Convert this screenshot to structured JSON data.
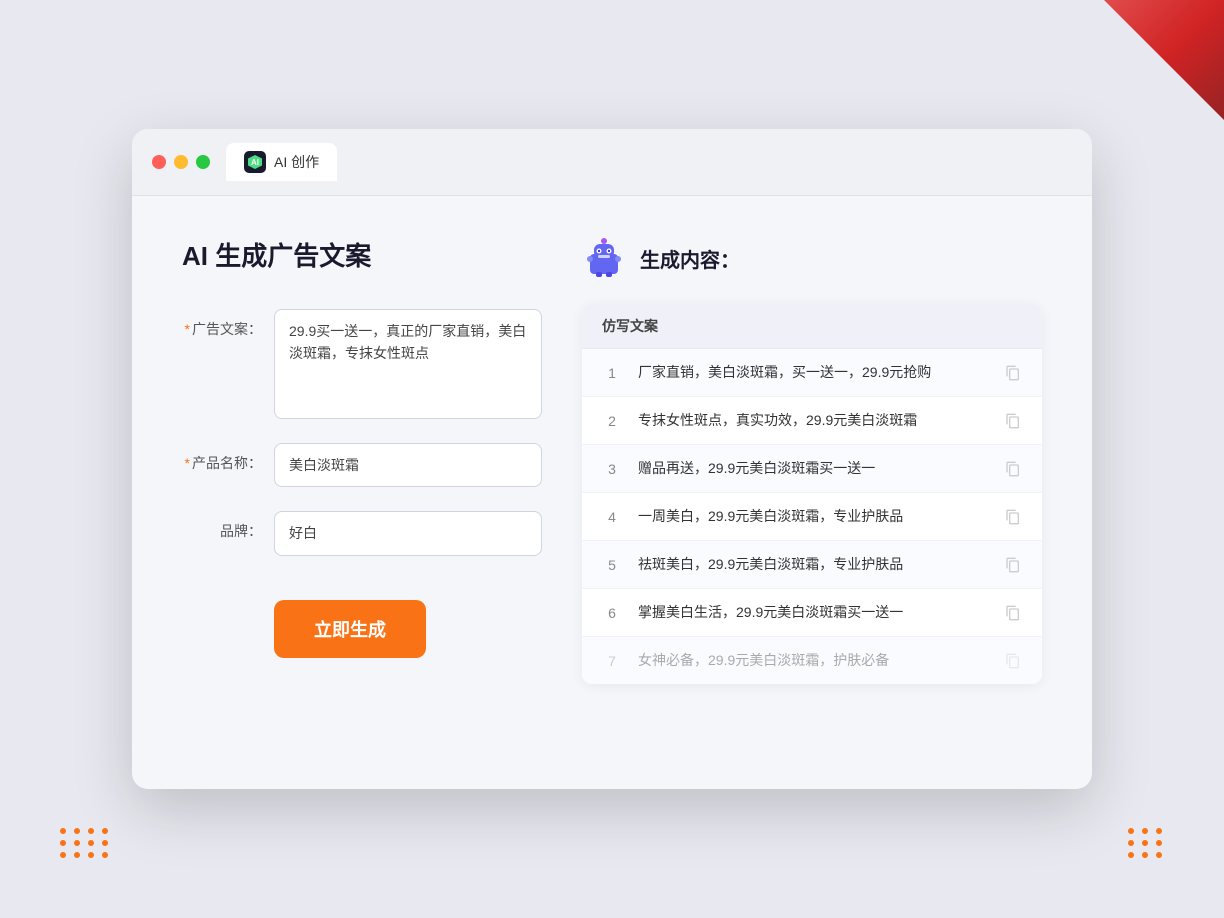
{
  "window": {
    "title": "AI 创作",
    "tab_label": "AI 创作"
  },
  "page": {
    "title": "AI 生成广告文案"
  },
  "form": {
    "ad_text_label": "广告文案：",
    "ad_text_required": "*",
    "ad_text_value": "29.9买一送一，真正的厂家直销，美白淡斑霜，专抹女性斑点",
    "product_name_label": "产品名称：",
    "product_name_required": "*",
    "product_name_value": "美白淡斑霜",
    "brand_label": "品牌：",
    "brand_value": "好白",
    "generate_button": "立即生成"
  },
  "result": {
    "header": "生成内容：",
    "table_column": "仿写文案",
    "items": [
      {
        "id": 1,
        "text": "厂家直销，美白淡斑霜，买一送一，29.9元抢购",
        "faded": false
      },
      {
        "id": 2,
        "text": "专抹女性斑点，真实功效，29.9元美白淡斑霜",
        "faded": false
      },
      {
        "id": 3,
        "text": "赠品再送，29.9元美白淡斑霜买一送一",
        "faded": false
      },
      {
        "id": 4,
        "text": "一周美白，29.9元美白淡斑霜，专业护肤品",
        "faded": false
      },
      {
        "id": 5,
        "text": "祛斑美白，29.9元美白淡斑霜，专业护肤品",
        "faded": false
      },
      {
        "id": 6,
        "text": "掌握美白生活，29.9元美白淡斑霜买一送一",
        "faded": false
      },
      {
        "id": 7,
        "text": "女神必备，29.9元美白淡斑霜，护肤必备",
        "faded": true
      }
    ]
  }
}
